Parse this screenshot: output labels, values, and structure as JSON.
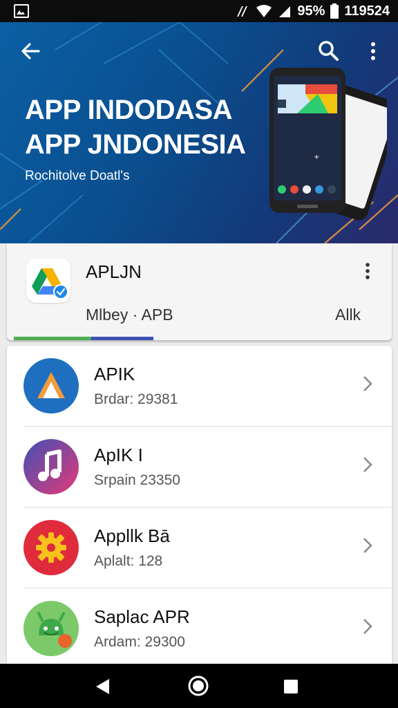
{
  "status_bar": {
    "battery": "95%",
    "time": "11:95:24",
    "time_display": "119524"
  },
  "hero": {
    "title_line1": "APP INDODASA",
    "title_line2": "APP JNDONESIA",
    "subtitle": "Rochitolve Doatl's",
    "colors": {
      "bg_start": "#0b5fa4",
      "bg_end": "#2a2a6b"
    }
  },
  "featured_card": {
    "title": "APLJN",
    "subtitle": "Mlbey · APB",
    "right_label": "Allk"
  },
  "apps": [
    {
      "name": "APIK",
      "meta": "Brdar: 29381",
      "icon": "triangle-a-icon"
    },
    {
      "name": "ApIK I",
      "meta": "Srpain 23350",
      "icon": "music-note-icon"
    },
    {
      "name": "Appllk Bā",
      "meta": "Aplalt: 128",
      "icon": "gear-icon"
    },
    {
      "name": "Saplac APR",
      "meta": "Ardam: 29300",
      "icon": "android-icon"
    }
  ],
  "nav": {
    "back": "back-triangle-icon",
    "home": "home-circle-icon",
    "recent": "recent-square-icon"
  }
}
